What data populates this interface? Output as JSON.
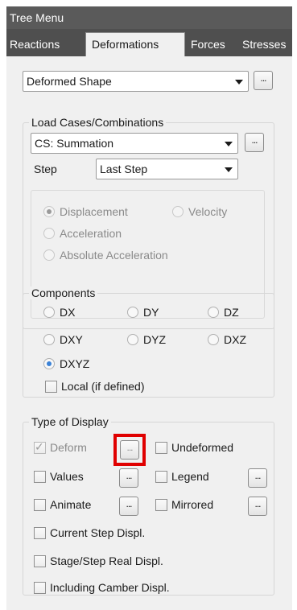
{
  "window": {
    "title": "Tree Menu"
  },
  "tabs": [
    "Reactions",
    "Deformations",
    "Forces",
    "Stresses"
  ],
  "display_type": {
    "selected": "Deformed Shape"
  },
  "load_cases": {
    "legend": "Load Cases/Combinations",
    "selected": "CS: Summation",
    "step_label": "Step",
    "step_selected": "Last Step",
    "modes": [
      "Displacement",
      "Velocity",
      "Acceleration",
      "Absolute Acceleration"
    ]
  },
  "components": {
    "legend": "Components",
    "options": [
      "DX",
      "DY",
      "DZ",
      "DXY",
      "DYZ",
      "DXZ",
      "DXYZ"
    ],
    "selected": "DXYZ",
    "local_label": "Local (if defined)"
  },
  "type_of_display": {
    "legend": "Type of Display",
    "deform": "Deform",
    "undeformed": "Undeformed",
    "values": "Values",
    "legend_option": "Legend",
    "animate": "Animate",
    "mirrored": "Mirrored",
    "current_step": "Current Step Displ.",
    "stage_step": "Stage/Step Real Displ.",
    "camber": "Including Camber Displ."
  },
  "ellipsis": "...",
  "highlight_color": "#e00000"
}
